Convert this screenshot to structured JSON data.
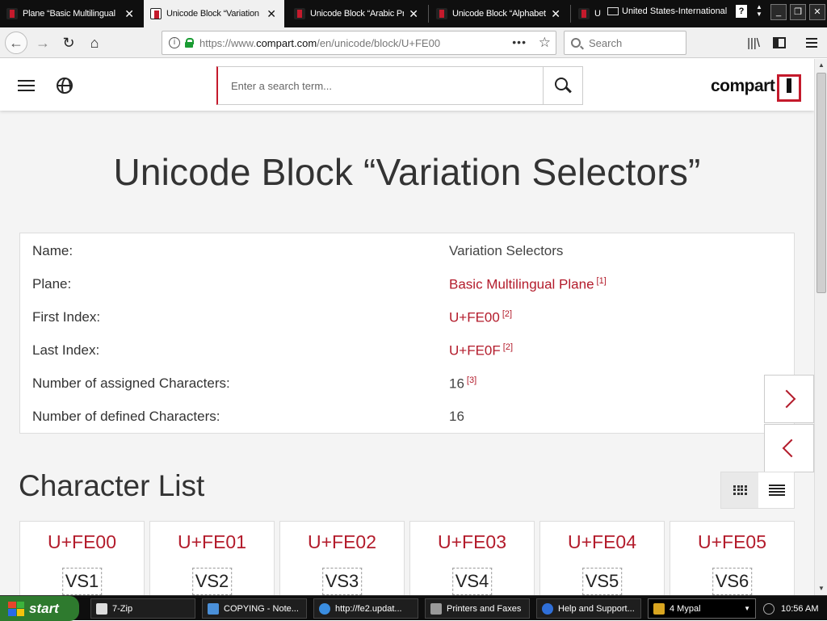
{
  "browser": {
    "tabs": [
      {
        "title": "Plane “Basic Multilingual",
        "active": false
      },
      {
        "title": "Unicode Block “Variation",
        "active": true
      },
      {
        "title": "Unicode Block “Arabic Pr",
        "active": false
      },
      {
        "title": "Unicode Block “Alphabet",
        "active": false
      },
      {
        "title": "U",
        "active": false
      }
    ],
    "ime_label": "United States-International",
    "help_label": "?",
    "window_buttons": {
      "minimize": "_",
      "maximize": "❐",
      "close": "✕"
    },
    "url": {
      "protocol": "https://www.",
      "host": "compart.com",
      "path": "/en/unicode/block/U+FE00"
    },
    "search_placeholder": "Search",
    "page_actions": "•••"
  },
  "site": {
    "search_placeholder": "Enter a search term...",
    "logo": "compart"
  },
  "page": {
    "title": "Unicode Block “Variation Selectors”",
    "info": [
      {
        "label": "Name:",
        "value": "Variation Selectors",
        "link": false,
        "ref": ""
      },
      {
        "label": "Plane:",
        "value": "Basic Multilingual Plane",
        "link": true,
        "ref": "[1]"
      },
      {
        "label": "First Index:",
        "value": "U+FE00",
        "link": true,
        "ref": "[2]"
      },
      {
        "label": "Last Index:",
        "value": "U+FE0F",
        "link": true,
        "ref": "[2]"
      },
      {
        "label": "Number of assigned Characters:",
        "value": "16",
        "link": false,
        "ref": "[3]"
      },
      {
        "label": "Number of defined Characters:",
        "value": "16",
        "link": false,
        "ref": ""
      }
    ],
    "character_list_title": "Character List",
    "characters": [
      {
        "code": "U+FE00",
        "glyph": "VS1"
      },
      {
        "code": "U+FE01",
        "glyph": "VS2"
      },
      {
        "code": "U+FE02",
        "glyph": "VS3"
      },
      {
        "code": "U+FE03",
        "glyph": "VS4"
      },
      {
        "code": "U+FE04",
        "glyph": "VS5"
      },
      {
        "code": "U+FE05",
        "glyph": "VS6"
      }
    ]
  },
  "taskbar": {
    "start_label": "start",
    "tasks": [
      {
        "label": "7-Zip",
        "icon_color": "#dddddd"
      },
      {
        "label": "COPYING - Note...",
        "icon_color": "#4a90d9"
      },
      {
        "label": "http://fe2.updat...",
        "icon_color": "#3a8de0"
      },
      {
        "label": "Printers and Faxes",
        "icon_color": "#9a9a9a"
      },
      {
        "label": "Help and Support...",
        "icon_color": "#2f6fd8"
      },
      {
        "label": "4 Mypal",
        "icon_color": "#d9a520"
      }
    ],
    "clock": "10:56 AM"
  },
  "colors": {
    "accent": "#b31b2b",
    "start_green": "#2e7a2e"
  }
}
